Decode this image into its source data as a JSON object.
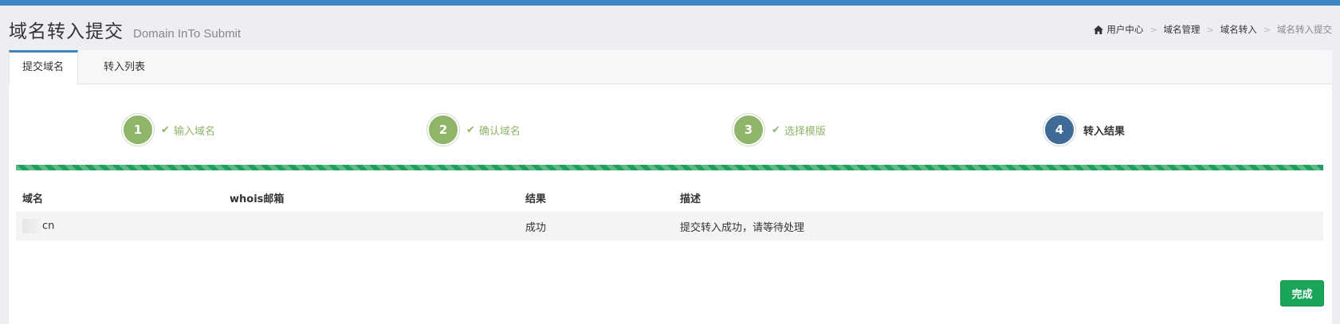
{
  "colors": {
    "topbar": "#3b85c3",
    "step_done": "#8fb46a",
    "step_current": "#3f6b96",
    "progress": "#1fa05a",
    "button": "#1aa55a"
  },
  "header": {
    "title": "域名转入提交",
    "subtitle": "Domain InTo Submit"
  },
  "breadcrumb": {
    "icon": "home-icon",
    "items": [
      "用户中心",
      "域名管理",
      "域名转入",
      "域名转入提交"
    ]
  },
  "tabs": [
    {
      "label": "提交域名",
      "active": true
    },
    {
      "label": "转入列表",
      "active": false
    }
  ],
  "steps": [
    {
      "number": "1",
      "label": "输入域名",
      "status": "done",
      "icon": "check-icon"
    },
    {
      "number": "2",
      "label": "确认域名",
      "status": "done",
      "icon": "check-icon"
    },
    {
      "number": "3",
      "label": "选择模版",
      "status": "done",
      "icon": "check-icon"
    },
    {
      "number": "4",
      "label": "转入结果",
      "status": "current"
    }
  ],
  "progress_percent": 100,
  "table": {
    "headers": [
      "域名",
      "whois邮箱",
      "结果",
      "描述"
    ],
    "rows": [
      {
        "domain": "cn",
        "whois_email": "",
        "result": "成功",
        "description": "提交转入成功，请等待处理"
      }
    ]
  },
  "actions": {
    "finish_label": "完成"
  }
}
